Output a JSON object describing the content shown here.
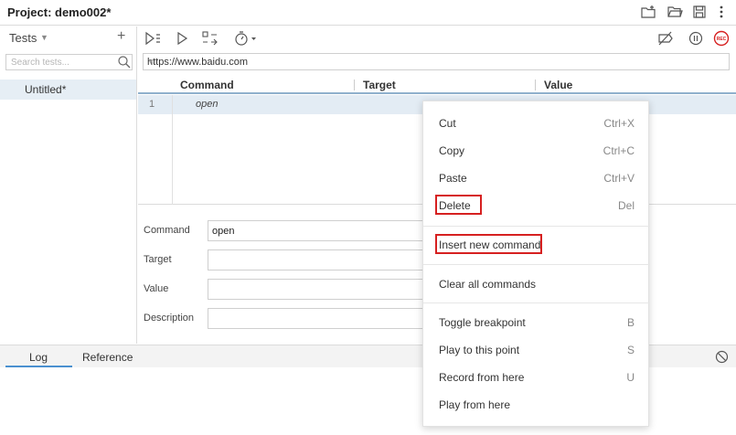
{
  "header": {
    "title": "Project:  demo002*",
    "icons": [
      "new-folder-icon",
      "open-folder-icon",
      "save-icon",
      "more-vertical-icon"
    ]
  },
  "sidebar": {
    "label": "Tests",
    "search_placeholder": "Search tests...",
    "items": [
      {
        "label": "Untitled*"
      }
    ]
  },
  "toolbar": {
    "icons": [
      "run-all-icon",
      "run-icon",
      "step-icon",
      "speed-icon",
      "disable-breakpoints-icon",
      "pause-icon",
      "record-icon"
    ],
    "record_label": "REC"
  },
  "url": {
    "value": "https://www.baidu.com"
  },
  "grid": {
    "columns": [
      "Command",
      "Target",
      "Value"
    ],
    "rows": [
      {
        "num": "1",
        "command": "open"
      }
    ]
  },
  "form": {
    "command_label": "Command",
    "command_value": "open",
    "target_label": "Target",
    "value_label": "Value",
    "description_label": "Description"
  },
  "bottom": {
    "tabs": [
      "Log",
      "Reference"
    ]
  },
  "context_menu": {
    "items": [
      {
        "label": "Cut",
        "shortcut": "Ctrl+X"
      },
      {
        "label": "Copy",
        "shortcut": "Ctrl+C"
      },
      {
        "label": "Paste",
        "shortcut": "Ctrl+V"
      },
      {
        "label": "Delete",
        "shortcut": "Del"
      },
      {
        "label": "Insert new command",
        "shortcut": ""
      },
      {
        "label": "Clear all commands",
        "shortcut": ""
      },
      {
        "label": "Toggle breakpoint",
        "shortcut": "B"
      },
      {
        "label": "Play to this point",
        "shortcut": "S"
      },
      {
        "label": "Record from here",
        "shortcut": "U"
      },
      {
        "label": "Play from here",
        "shortcut": ""
      }
    ]
  },
  "colors": {
    "accent": "#4a90d0",
    "highlight": "#d62020",
    "record": "#d62020"
  }
}
